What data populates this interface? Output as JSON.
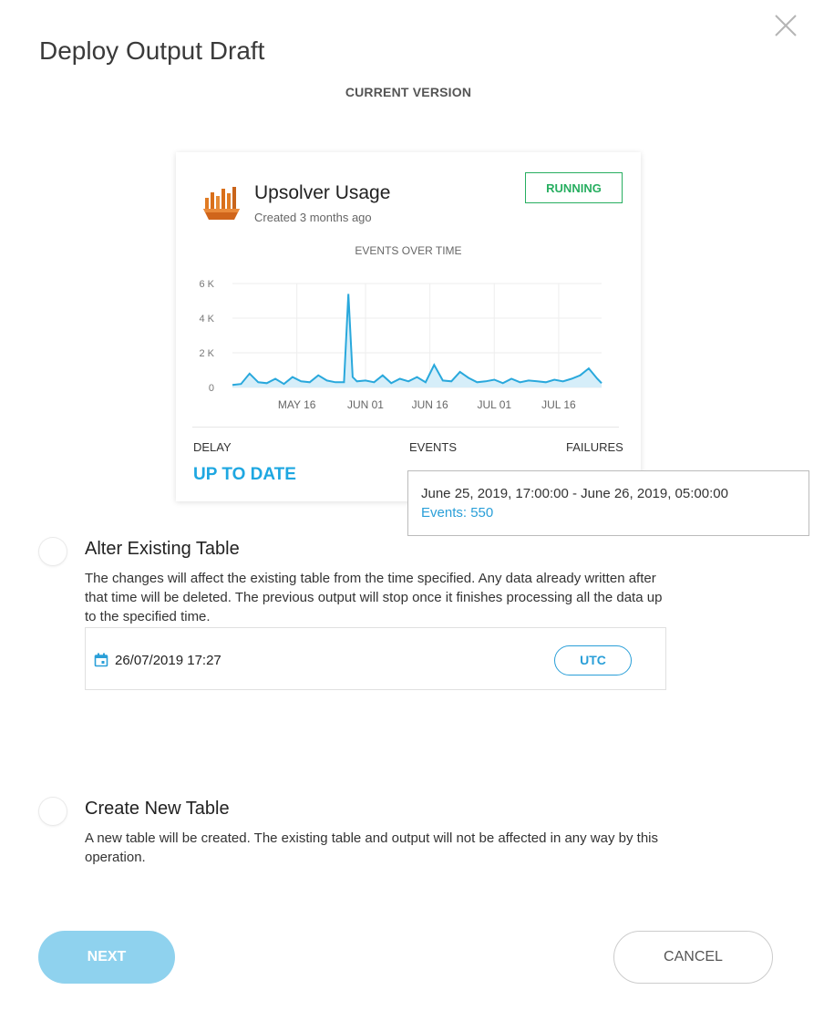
{
  "dialog": {
    "title": "Deploy Output Draft",
    "section_label": "CURRENT VERSION"
  },
  "card": {
    "name": "Upsolver Usage",
    "created": "Created 3 months ago",
    "status": "RUNNING",
    "status_color": "#27ae60",
    "chart_title": "EVENTS OVER TIME",
    "stats": [
      {
        "label": "DELAY",
        "value": "UP TO DATE"
      },
      {
        "label": "EVENTS",
        "value": ""
      },
      {
        "label": "FAILURES",
        "value": ""
      }
    ]
  },
  "tooltip": {
    "range": "June 25, 2019, 17:00:00 - June 26, 2019, 05:00:00",
    "events": "Events: 550"
  },
  "options": [
    {
      "title": "Alter Existing Table",
      "description": "The changes will affect the existing table from the time specified. Any data already written after that time will be deleted. The previous output will stop once it finishes processing all the data up to the specified time.",
      "date_value": "26/07/2019 17:27",
      "timezone_button": "UTC"
    },
    {
      "title": "Create New Table",
      "description": "A new table will be created. The existing table and output will not be affected in any way by this operation."
    }
  ],
  "buttons": {
    "next": "NEXT",
    "cancel": "CANCEL"
  },
  "colors": {
    "accent": "#1ea7e1",
    "series": "#29a8dc",
    "series_fill": "#d6eef9"
  },
  "icons": {
    "close": "close-icon",
    "logo": "upsolver-logo-icon",
    "calendar": "calendar-icon"
  },
  "chart_data": {
    "type": "area",
    "title": "EVENTS OVER TIME",
    "x_tick_labels": [
      "MAY 16",
      "JUN 01",
      "JUN 16",
      "JUL 01",
      "JUL 16"
    ],
    "y_tick_labels": [
      "6 K",
      "4 K",
      "2 K",
      "0"
    ],
    "ylim": [
      0,
      6000
    ],
    "x_range": [
      "2019-05-01",
      "2019-07-26"
    ],
    "grid": true,
    "series": [
      {
        "x": [
          "2019-05-01",
          "2019-05-03",
          "2019-05-05",
          "2019-05-07",
          "2019-05-09",
          "2019-05-11",
          "2019-05-13",
          "2019-05-15",
          "2019-05-17",
          "2019-05-19",
          "2019-05-21",
          "2019-05-23",
          "2019-05-25",
          "2019-05-27",
          "2019-05-28",
          "2019-05-29",
          "2019-05-30",
          "2019-06-01",
          "2019-06-03",
          "2019-06-05",
          "2019-06-07",
          "2019-06-09",
          "2019-06-11",
          "2019-06-13",
          "2019-06-15",
          "2019-06-17",
          "2019-06-19",
          "2019-06-21",
          "2019-06-23",
          "2019-06-25",
          "2019-06-27",
          "2019-06-29",
          "2019-07-01",
          "2019-07-03",
          "2019-07-05",
          "2019-07-07",
          "2019-07-09",
          "2019-07-11",
          "2019-07-13",
          "2019-07-15",
          "2019-07-17",
          "2019-07-19",
          "2019-07-21",
          "2019-07-23",
          "2019-07-25",
          "2019-07-26"
        ],
        "values": [
          150,
          200,
          800,
          300,
          250,
          500,
          200,
          600,
          350,
          300,
          700,
          400,
          300,
          300,
          5400,
          600,
          350,
          400,
          300,
          700,
          250,
          500,
          350,
          600,
          300,
          1300,
          400,
          350,
          900,
          550,
          300,
          350,
          450,
          250,
          500,
          300,
          400,
          350,
          300,
          450,
          350,
          500,
          700,
          1100,
          500,
          250
        ]
      }
    ]
  }
}
